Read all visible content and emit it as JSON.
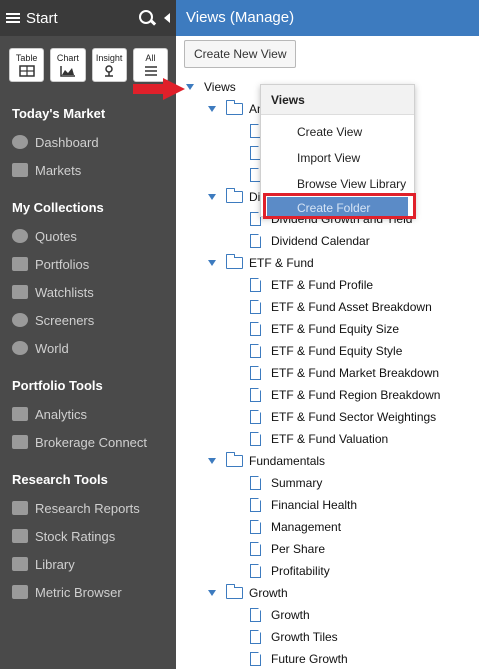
{
  "sidebar": {
    "title": "Start",
    "quick_buttons": [
      {
        "label": "Table",
        "icon": "table-icon"
      },
      {
        "label": "Chart",
        "icon": "chart-icon"
      },
      {
        "label": "Insight",
        "icon": "insight-icon"
      },
      {
        "label": "All",
        "icon": "list-icon"
      }
    ],
    "sections": [
      {
        "heading": "Today's Market",
        "items": [
          {
            "label": "Dashboard",
            "icon": "dashboard-icon"
          },
          {
            "label": "Markets",
            "icon": "markets-icon"
          }
        ]
      },
      {
        "heading": "My Collections",
        "items": [
          {
            "label": "Quotes",
            "icon": "quotes-icon"
          },
          {
            "label": "Portfolios",
            "icon": "portfolios-icon"
          },
          {
            "label": "Watchlists",
            "icon": "binoculars-icon"
          },
          {
            "label": "Screeners",
            "icon": "search-icon"
          },
          {
            "label": "World",
            "icon": "globe-icon"
          }
        ]
      },
      {
        "heading": "Portfolio Tools",
        "items": [
          {
            "label": "Analytics",
            "icon": "analytics-icon"
          },
          {
            "label": "Brokerage Connect",
            "icon": "bank-icon"
          }
        ]
      },
      {
        "heading": "Research Tools",
        "items": [
          {
            "label": "Research Reports",
            "icon": "reports-icon"
          },
          {
            "label": "Stock Ratings",
            "icon": "star-icon"
          },
          {
            "label": "Library",
            "icon": "library-icon"
          },
          {
            "label": "Metric Browser",
            "icon": "metric-browser-icon"
          }
        ]
      }
    ]
  },
  "main": {
    "title": "Views (Manage)",
    "create_button": "Create New View",
    "tree": {
      "root": "Views",
      "folders": [
        {
          "label": "An",
          "items": [
            "",
            "",
            ""
          ]
        },
        {
          "label": "Di",
          "items": [
            "Dividend Growth and Yield",
            "Dividend Calendar"
          ]
        },
        {
          "label": "ETF & Fund",
          "items": [
            "ETF & Fund Profile",
            "ETF & Fund Asset Breakdown",
            "ETF & Fund Equity Size",
            "ETF & Fund Equity Style",
            "ETF & Fund Market Breakdown",
            "ETF & Fund Region Breakdown",
            "ETF & Fund Sector Weightings",
            "ETF & Fund Valuation"
          ]
        },
        {
          "label": "Fundamentals",
          "items": [
            "Summary",
            "Financial Health",
            "Management",
            "Per Share",
            "Profitability"
          ]
        },
        {
          "label": "Growth",
          "items": [
            "Growth",
            "Growth Tiles",
            "Future Growth"
          ]
        }
      ]
    },
    "context_menu": {
      "title": "Views",
      "items": [
        "Create View",
        "Import View",
        "Browse View Library",
        "Create Folder"
      ],
      "highlighted": "Create Folder"
    }
  },
  "colors": {
    "accent": "#3d7bbf",
    "sidebar_bg": "#4a4a4a",
    "highlight_border": "#e0202a"
  }
}
